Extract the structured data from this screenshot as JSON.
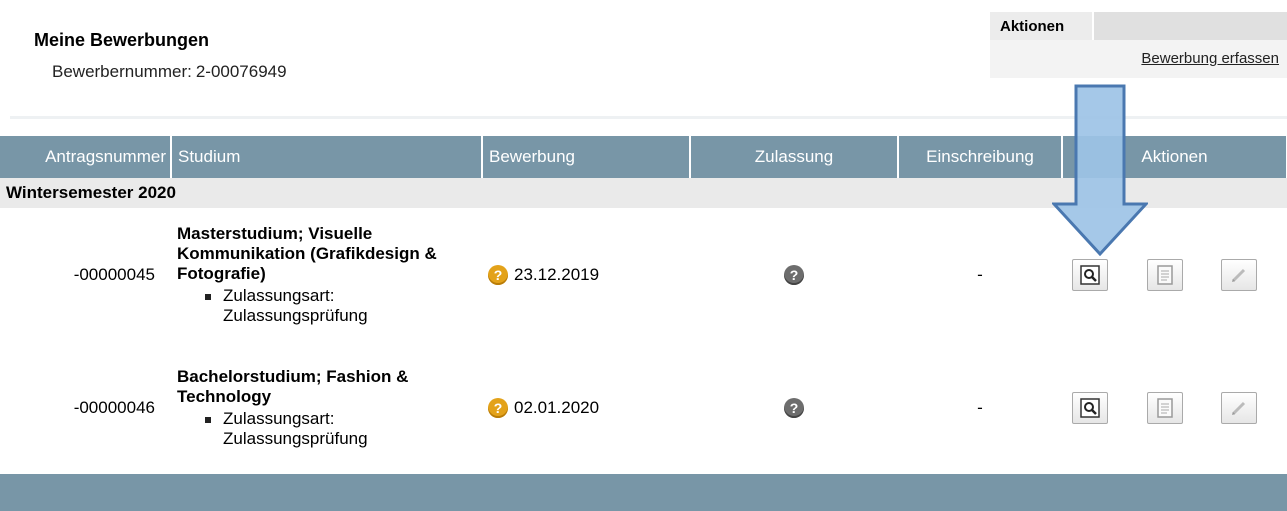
{
  "header": {
    "title": "Meine Bewerbungen",
    "applicant_label": "Bewerbernummer:",
    "applicant_number": "2-00076949"
  },
  "actions_box": {
    "heading": "Aktionen",
    "link": "Bewerbung erfassen"
  },
  "table": {
    "columns": [
      "Antragsnummer",
      "Studium",
      "Bewerbung",
      "Zulassung",
      "Einschreibung",
      "Aktionen"
    ],
    "semester": "Wintersemester 2020",
    "rows": [
      {
        "number": "-00000045",
        "study_title": "Masterstudium; Visuelle Kommunikation (Grafikdesign & Fotografie)",
        "detail_label": "Zulassungsart:",
        "detail_value": "Zulassungsprüfung",
        "application_date": "23.12.2019",
        "enrollment": "-"
      },
      {
        "number": "-00000046",
        "study_title": "Bachelorstudium; Fashion & Technology",
        "detail_label": "Zulassungsart:",
        "detail_value": "Zulassungsprüfung",
        "application_date": "02.01.2020",
        "enrollment": "-"
      }
    ]
  },
  "icons": {
    "status_pending": "question-mark-icon",
    "view": "magnifier-icon",
    "document": "document-icon",
    "edit": "pencil-icon"
  },
  "colors": {
    "table_header": "#7896a7",
    "semester_row": "#eaeaea",
    "pending_icon": "#e3a21a",
    "arrow_fill": "#9dc3e6",
    "arrow_stroke": "#4a78b0"
  }
}
